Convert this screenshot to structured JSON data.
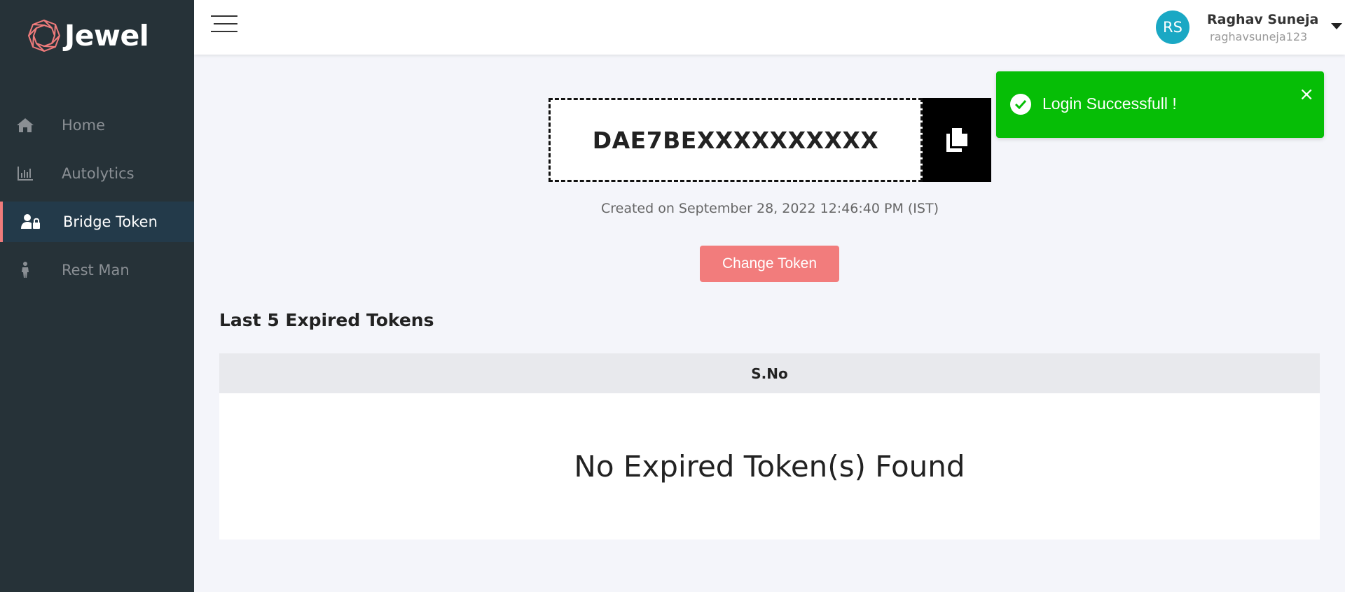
{
  "brand": {
    "name": "Jewel",
    "accent": "#ef7b7b"
  },
  "sidebar": {
    "items": [
      {
        "label": "Home",
        "icon": "home-icon",
        "active": false
      },
      {
        "label": "Autolytics",
        "icon": "bar-chart-icon",
        "active": false
      },
      {
        "label": "Bridge Token",
        "icon": "user-lock-icon",
        "active": true
      },
      {
        "label": "Rest Man",
        "icon": "walking-person-icon",
        "active": false
      }
    ]
  },
  "header": {
    "user": {
      "initials": "RS",
      "name": "Raghav Suneja",
      "handle": "raghavsuneja123",
      "avatar_color": "#1aa8c4"
    }
  },
  "toast": {
    "message": "Login Successfull !",
    "color": "#06be06",
    "close": "×"
  },
  "token": {
    "value": "DAE7BEXXXXXXXXXX",
    "created": "Created on September 28, 2022 12:46:40 PM (IST)",
    "change_label": "Change Token"
  },
  "expired": {
    "title": "Last 5 Expired Tokens",
    "columns": [
      "S.No"
    ],
    "empty_message": "No Expired Token(s) Found"
  }
}
